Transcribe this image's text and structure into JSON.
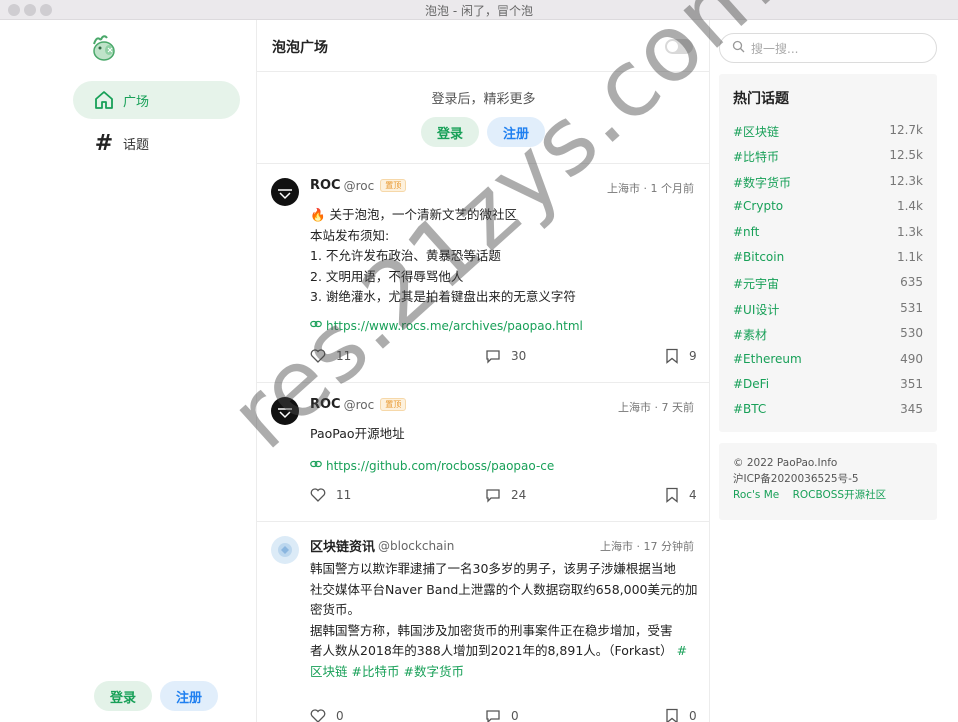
{
  "window": {
    "title": "泡泡 - 闲了，冒个泡"
  },
  "sidebar": {
    "nav": [
      {
        "label": "广场",
        "icon": "home-icon"
      },
      {
        "label": "话题",
        "icon": "hash-icon"
      }
    ],
    "login_label": "登录",
    "register_label": "注册"
  },
  "main": {
    "title": "泡泡广场",
    "login_prompt": "登录后，精彩更多",
    "login_label": "登录",
    "register_label": "注册",
    "posts": [
      {
        "nickname": "ROC",
        "handle": "@roc",
        "badge": "置顶",
        "meta": "上海市 · 1 个月前",
        "body": "🔥 关于泡泡，一个清新文艺的微社区\n本站发布须知:\n1. 不允许发布政治、黄暴恐等话题\n2. 文明用语，不得辱骂他人\n3. 谢绝灌水，尤其是拍着键盘出来的无意义字符",
        "link": "https://www.rocs.me/archives/paopao.html",
        "likes": "11",
        "comments": "30",
        "collects": "9"
      },
      {
        "nickname": "ROC",
        "handle": "@roc",
        "badge": "置顶",
        "meta": "上海市 · 7 天前",
        "body": "PaoPao开源地址",
        "link": "https://github.com/rocboss/paopao-ce",
        "likes": "11",
        "comments": "24",
        "collects": "4"
      },
      {
        "nickname": "区块链资讯",
        "handle": "@blockchain",
        "meta": "上海市 · 17 分钟前",
        "body_lines": [
          "韩国警方以欺诈罪逮捕了一名30多岁的男子，该男子涉嫌根据当地",
          "社交媒体平台Naver Band上泄露的个人数据窃取约658,000美元的加",
          "密货币。",
          "据韩国警方称，韩国涉及加密货币的刑事案件正在稳步增加，受害",
          "者人数从2018年的388人增加到2021年的8,891人。（Forkast）"
        ],
        "tag_inline": "#",
        "tags_line": [
          "区块链",
          "#比特币",
          "#数字货币"
        ],
        "likes": "0",
        "comments": "0",
        "collects": "0"
      }
    ]
  },
  "right": {
    "search_placeholder": "搜一搜...",
    "hot_title": "热门话题",
    "topics": [
      {
        "name": "#区块链",
        "count": "12.7k"
      },
      {
        "name": "#比特币",
        "count": "12.5k"
      },
      {
        "name": "#数字货币",
        "count": "12.3k"
      },
      {
        "name": "#Crypto",
        "count": "1.4k"
      },
      {
        "name": "#nft",
        "count": "1.3k"
      },
      {
        "name": "#Bitcoin",
        "count": "1.1k"
      },
      {
        "name": "#元宇宙",
        "count": "635"
      },
      {
        "name": "#UI设计",
        "count": "531"
      },
      {
        "name": "#素材",
        "count": "530"
      },
      {
        "name": "#Ethereum",
        "count": "490"
      },
      {
        "name": "#DeFi",
        "count": "351"
      },
      {
        "name": "#BTC",
        "count": "345"
      }
    ],
    "footer": {
      "copyright": "© 2022 PaoPao.Info",
      "icp": "沪ICP备2020036525号-5",
      "links": [
        "Roc's Me",
        "ROCBOSS开源社区"
      ]
    }
  },
  "watermark": "res.21zys.com",
  "colors": {
    "accent": "#18a058",
    "blue": "#2080f0"
  }
}
